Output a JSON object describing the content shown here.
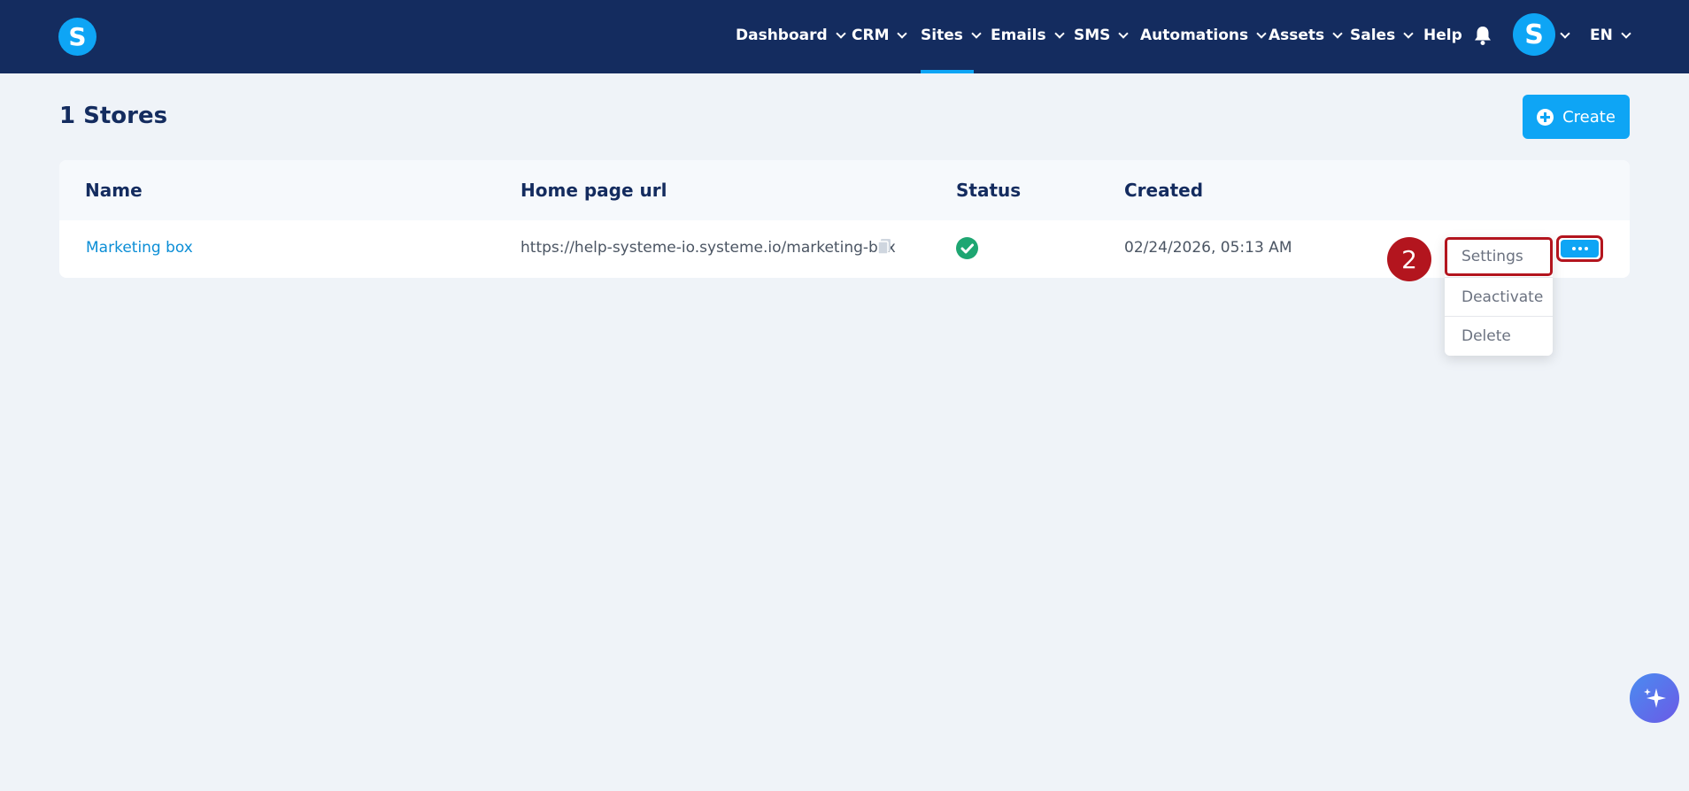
{
  "nav": {
    "logo": "S",
    "items": [
      {
        "label": "Dashboard",
        "has_menu": true
      },
      {
        "label": "CRM",
        "has_menu": true
      },
      {
        "label": "Sites",
        "has_menu": true,
        "active": true
      },
      {
        "label": "Emails",
        "has_menu": true
      },
      {
        "label": "SMS",
        "has_menu": true
      },
      {
        "label": "Automations",
        "has_menu": true
      },
      {
        "label": "Assets",
        "has_menu": true
      },
      {
        "label": "Sales",
        "has_menu": true
      },
      {
        "label": "Help",
        "has_menu": false
      }
    ],
    "bell_icon": "bell-icon",
    "avatar_letter": "S",
    "language": "EN"
  },
  "page": {
    "title": "1 Stores",
    "create_label": "Create"
  },
  "table": {
    "columns": [
      "Name",
      "Home page url",
      "Status",
      "Created"
    ],
    "rows": [
      {
        "name": "Marketing box",
        "url": "https://help-systeme-io.systeme.io/marketing-box",
        "status": "active",
        "created": "02/24/2026, 05:13 AM"
      }
    ]
  },
  "annotation": {
    "step": "2"
  },
  "menu": {
    "items": [
      "Settings",
      "Deactivate",
      "Delete"
    ]
  },
  "colors": {
    "nav_bg": "#142c5f",
    "accent": "#0ea5f5",
    "highlight": "#b3151e",
    "status_ok": "#1ea672"
  }
}
